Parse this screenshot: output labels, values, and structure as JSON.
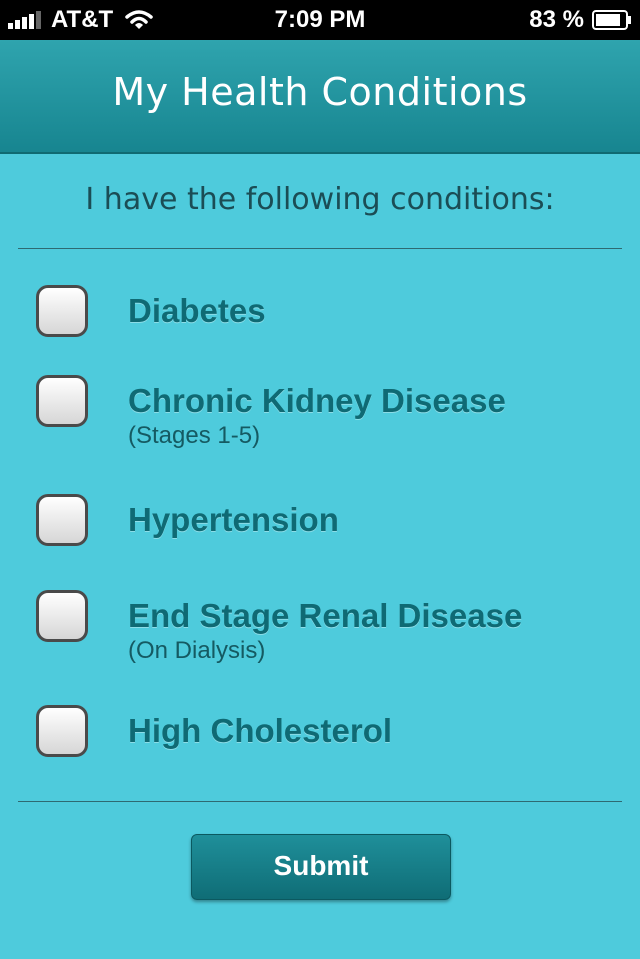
{
  "status_bar": {
    "carrier": "AT&T",
    "time": "7:09 PM",
    "battery": "83 %",
    "icons": [
      "signal-icon",
      "wifi-icon",
      "battery-icon"
    ]
  },
  "header": {
    "title": "My Health Conditions"
  },
  "intro": "I have the following conditions:",
  "conditions": [
    {
      "label": "Diabetes",
      "sub": "",
      "checked": false
    },
    {
      "label": "Chronic Kidney Disease",
      "sub": "(Stages 1-5)",
      "checked": false
    },
    {
      "label": "Hypertension",
      "sub": "",
      "checked": false
    },
    {
      "label": "End Stage Renal Disease",
      "sub": "(On Dialysis)",
      "checked": false
    },
    {
      "label": "High Cholesterol",
      "sub": "",
      "checked": false
    }
  ],
  "submit_label": "Submit",
  "colors": {
    "background": "#4ecbdc",
    "header": "#1b8b95",
    "label": "#0f6a74",
    "button": "#17808a"
  }
}
